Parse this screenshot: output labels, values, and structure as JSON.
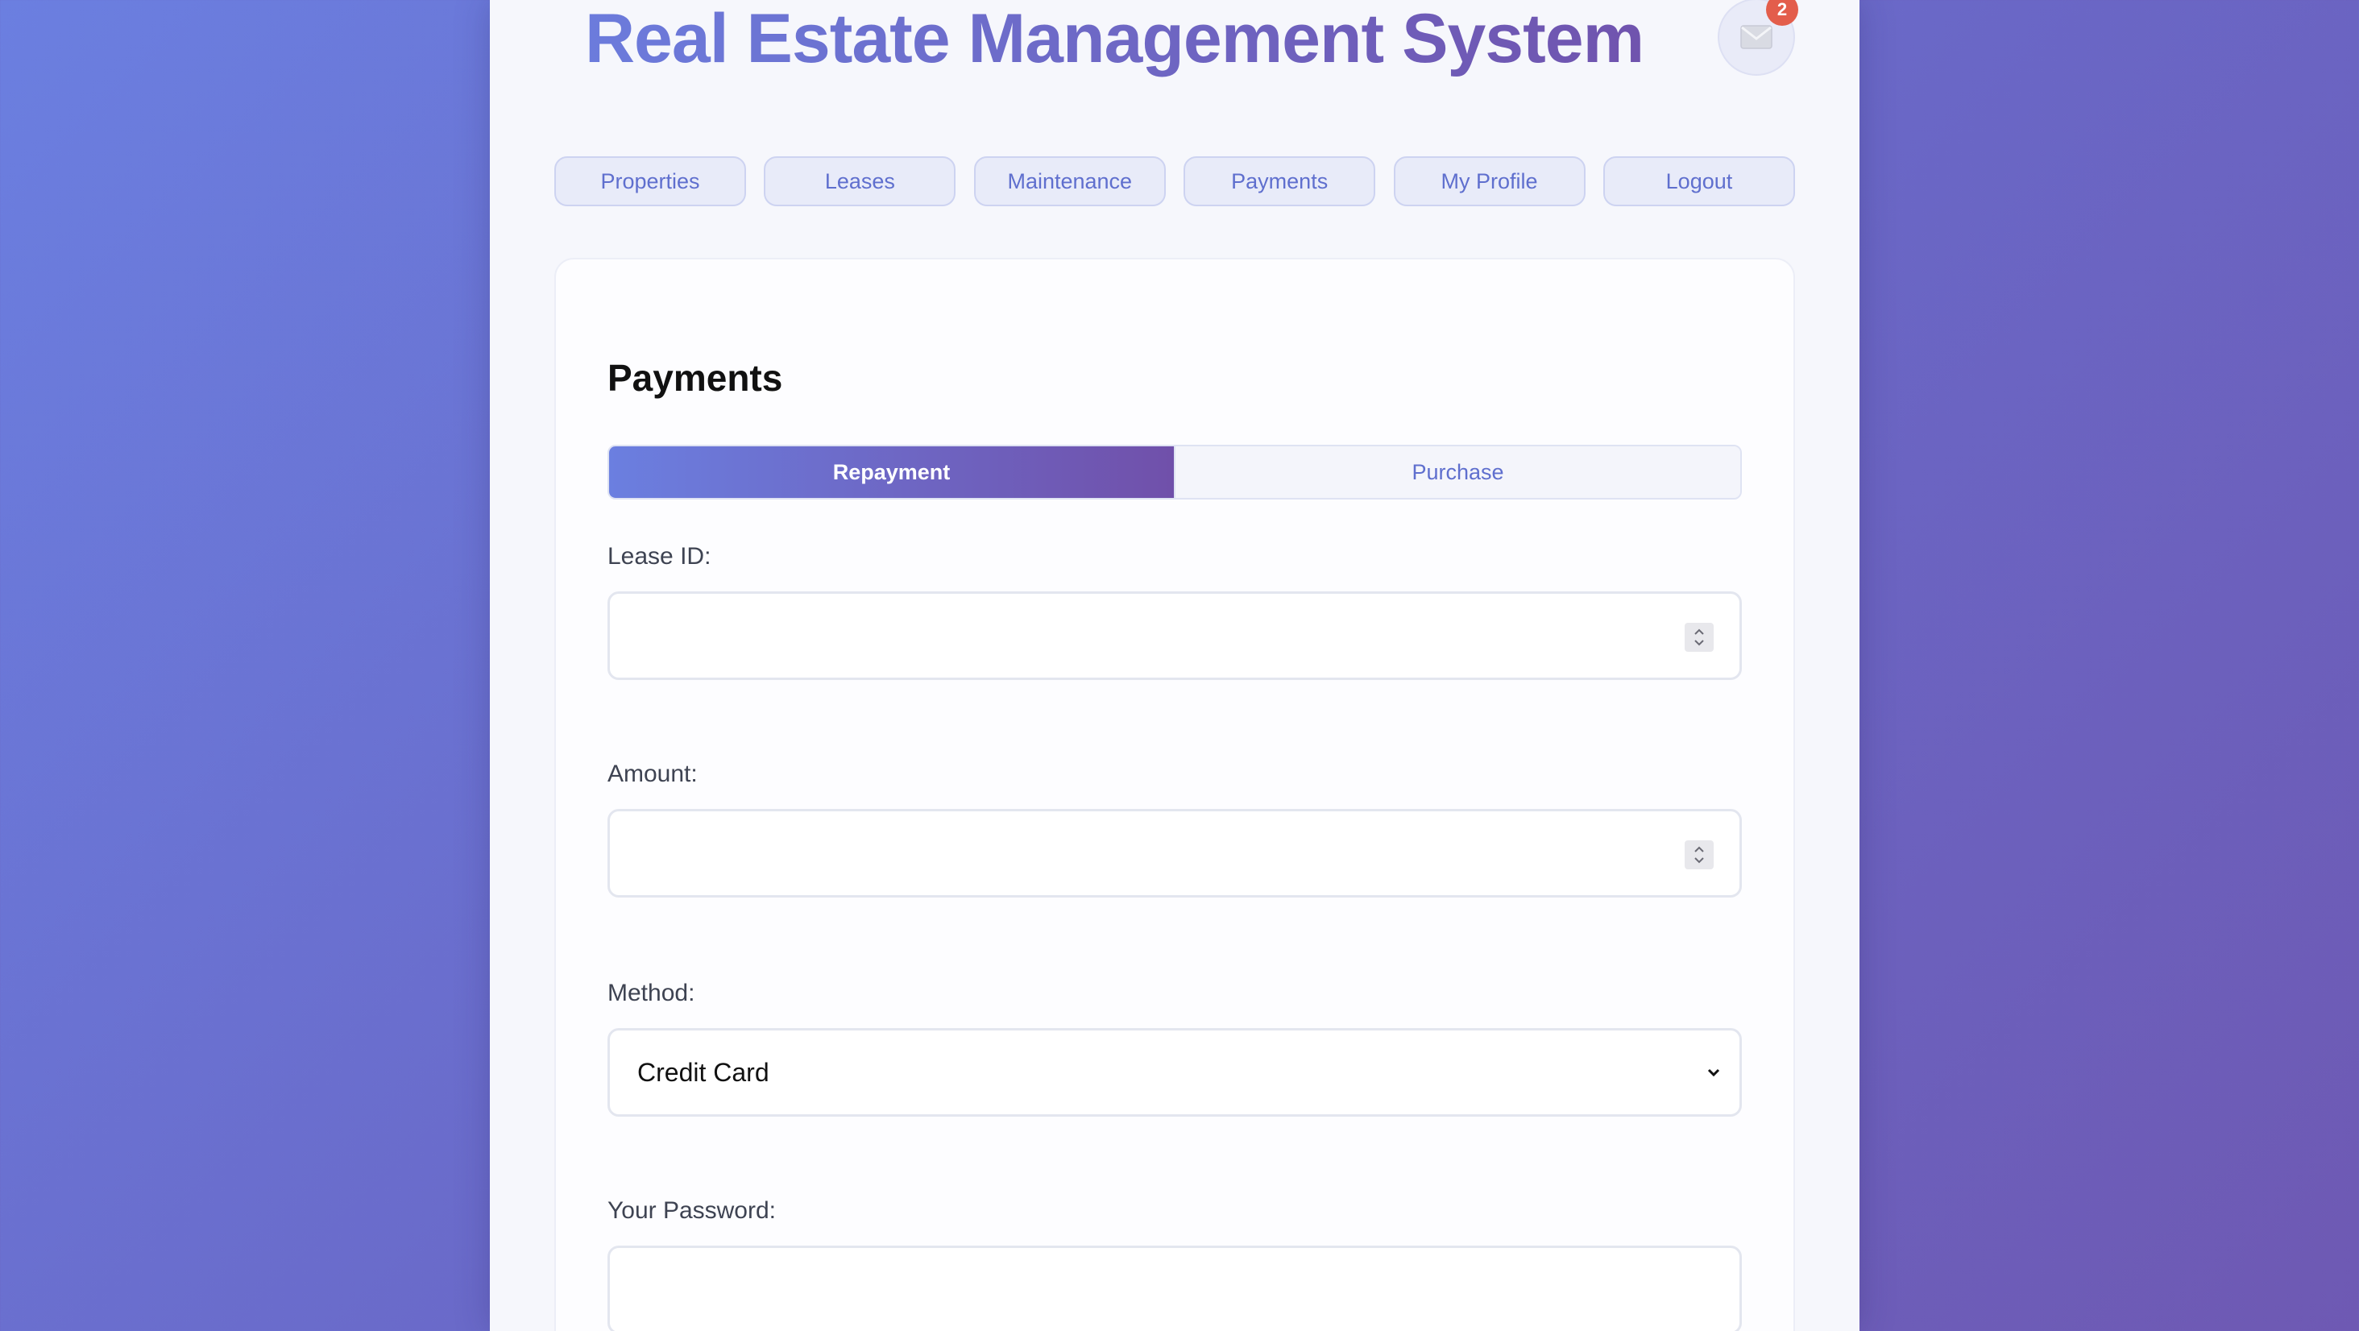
{
  "app": {
    "title": "Real Estate Management System",
    "notifications": {
      "icon": "mail-icon",
      "count": "2"
    }
  },
  "nav": {
    "items": [
      {
        "label": "Properties"
      },
      {
        "label": "Leases"
      },
      {
        "label": "Maintenance"
      },
      {
        "label": "Payments"
      },
      {
        "label": "My Profile"
      },
      {
        "label": "Logout"
      }
    ]
  },
  "payments": {
    "heading": "Payments",
    "tabs": [
      {
        "label": "Repayment",
        "active": true
      },
      {
        "label": "Purchase",
        "active": false
      }
    ],
    "form": {
      "lease_id": {
        "label": "Lease ID:",
        "value": ""
      },
      "amount": {
        "label": "Amount:",
        "value": ""
      },
      "method": {
        "label": "Method:",
        "value": "Credit Card"
      },
      "password": {
        "label": "Your Password:",
        "value": ""
      }
    }
  },
  "colors": {
    "accent_start": "#6b7fe0",
    "accent_end": "#7050aa",
    "badge": "#e35d4b"
  }
}
